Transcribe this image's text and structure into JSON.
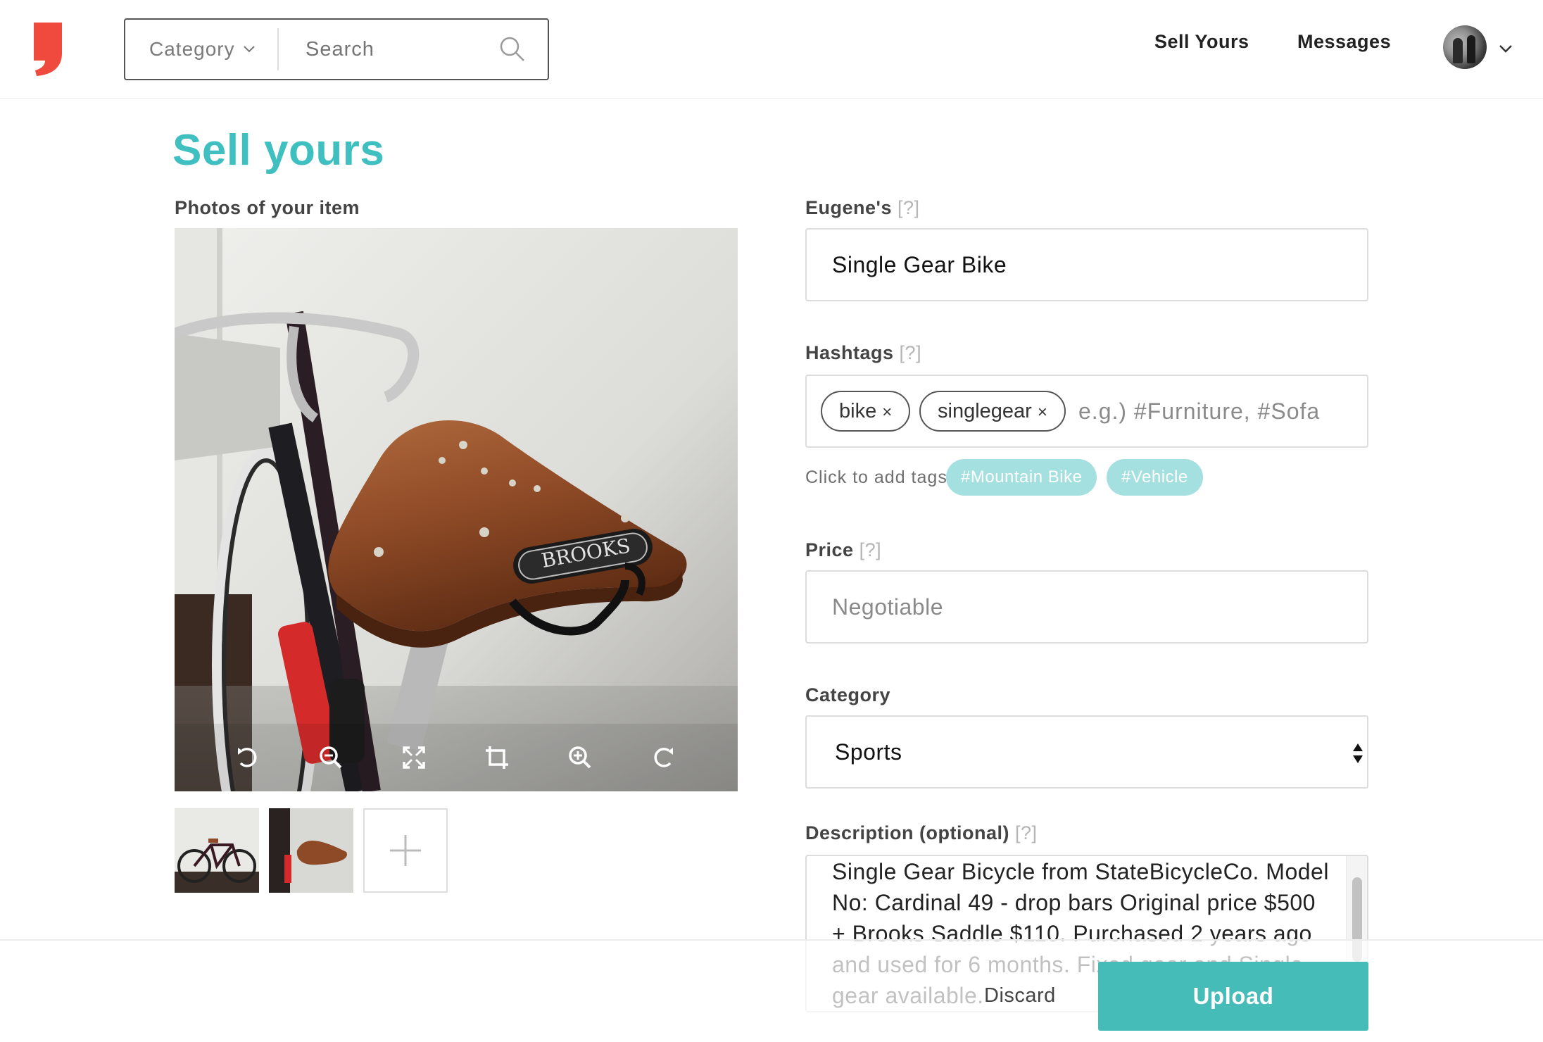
{
  "header": {
    "category_label": "Category",
    "search_placeholder": "Search",
    "nav_sell": "Sell Yours",
    "nav_messages": "Messages"
  },
  "page": {
    "title": "Sell yours",
    "photos_label": "Photos of your item"
  },
  "form": {
    "help": "[?]",
    "title_label": "Eugene's",
    "title_value": "Single Gear Bike",
    "hashtags_label": "Hashtags",
    "tags": [
      "bike",
      "singlegear"
    ],
    "tag_remove": "×",
    "hashtags_placeholder": "e.g.) #Furniture, #Sofa",
    "suggest_label": "Click to add tags",
    "suggestions": [
      "#Mountain Bike",
      "#Vehicle"
    ],
    "price_label": "Price",
    "price_placeholder": "Negotiable",
    "category_label": "Category",
    "category_value": "Sports",
    "description_label": "Description (optional)",
    "description_value": "Single Gear Bicycle from StateBicycleCo. Model No: Cardinal 49 - drop bars Original price $500 + Brooks Saddle $110. Purchased 2 years ago and used for 6 months. Fixed gear and Single gear available."
  },
  "photo": {
    "saddle_brand": "BROOKS"
  },
  "actions": {
    "discard": "Discard",
    "upload": "Upload"
  },
  "colors": {
    "accent": "#3fbfbf",
    "brand_red": "#f04a3e",
    "upload_bg": "#45bcb8",
    "suggestion_bg": "#a5e0e0"
  }
}
